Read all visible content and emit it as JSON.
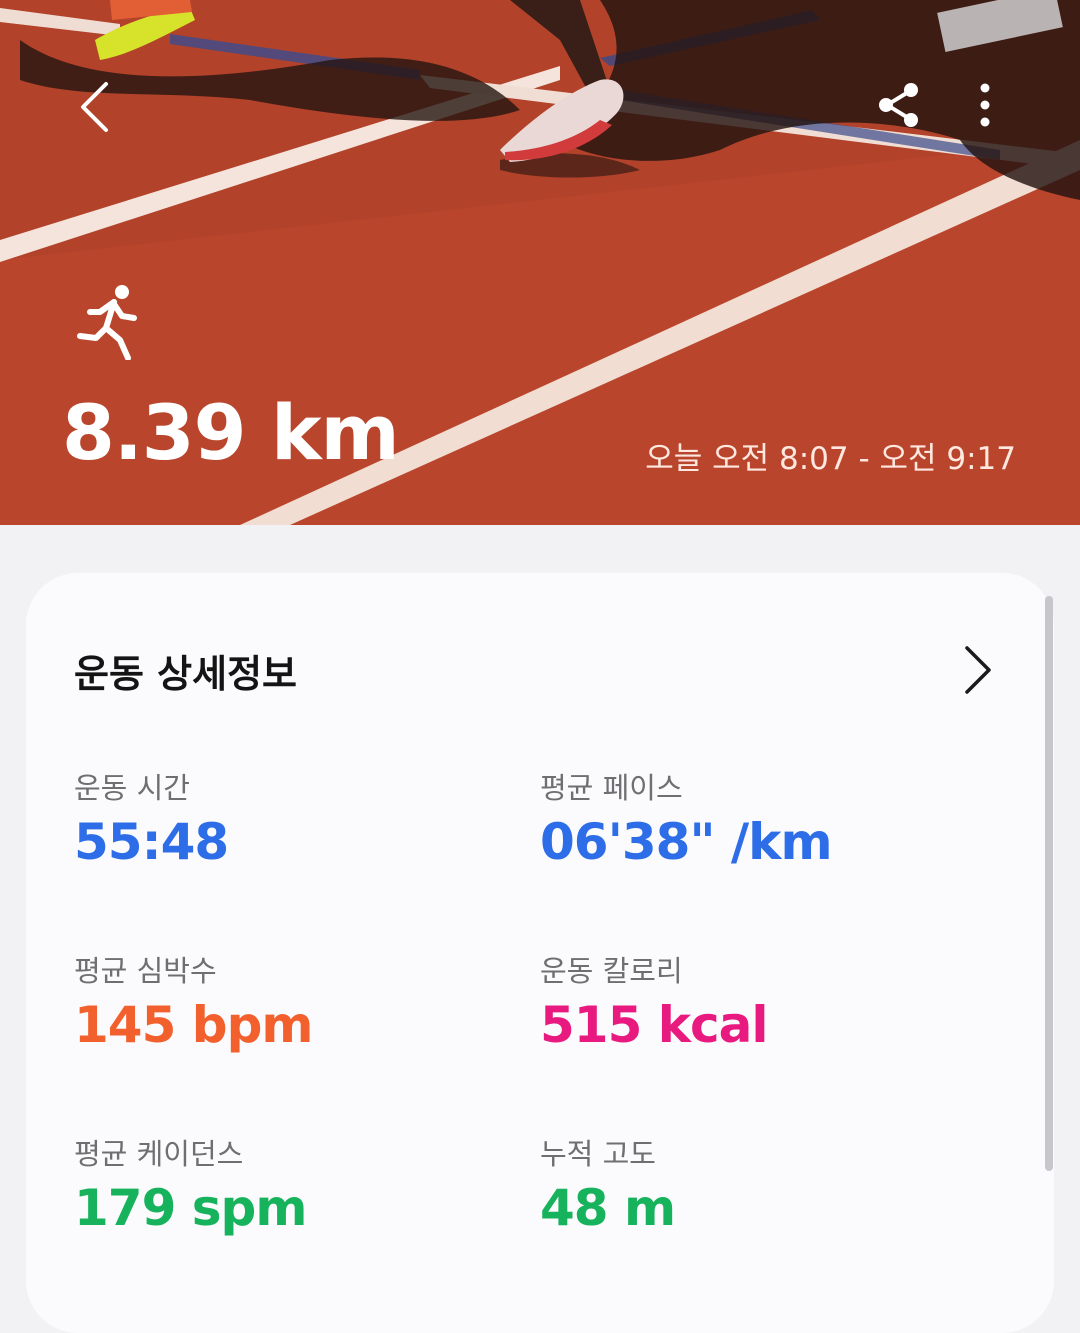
{
  "hero": {
    "distance": "8.39 km",
    "time_range": "오늘 오전 8:07 - 오전 9:17",
    "background_color": "#b8452a",
    "icons": {
      "back": "chevron-left-icon",
      "share": "share-icon",
      "more": "more-vertical-icon",
      "activity": "running-icon"
    }
  },
  "details": {
    "title": "운동 상세정보",
    "stats": [
      {
        "label": "운동 시간",
        "value": "55:48",
        "color": "#2d6ee8"
      },
      {
        "label": "평균 페이스",
        "value": "06'38\" /km",
        "color": "#2d6ee8"
      },
      {
        "label": "평균 심박수",
        "value": "145 bpm",
        "color": "#f2602e"
      },
      {
        "label": "운동 칼로리",
        "value": "515 kcal",
        "color": "#e8197f"
      },
      {
        "label": "평균 케이던스",
        "value": "179 spm",
        "color": "#16b25c"
      },
      {
        "label": "누적 고도",
        "value": "48 m",
        "color": "#16b25c"
      }
    ]
  }
}
